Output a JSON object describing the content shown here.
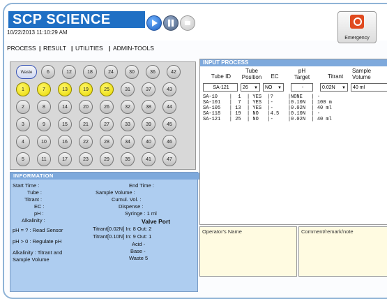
{
  "app": {
    "title": "SCP SCIENCE",
    "datetime": "10/22/2013 11:10:29 AM"
  },
  "controls": {
    "play": "play-icon",
    "pause": "pause-icon",
    "stop": "stop-icon",
    "emergency_label": "Emergency",
    "emergency_color": "#e04a1f"
  },
  "menu": {
    "items": [
      {
        "label": "PROCESS"
      },
      {
        "label": "RESULT"
      },
      {
        "label": "UTILITIES"
      },
      {
        "label": "ADMIN-TOOLS"
      }
    ]
  },
  "tube_rack": {
    "waste_label": "Waste",
    "rows": [
      [
        6,
        12,
        18,
        24,
        30,
        36,
        42
      ],
      [
        1,
        7,
        13,
        19,
        25,
        31,
        37,
        43
      ],
      [
        2,
        8,
        14,
        20,
        26,
        32,
        38,
        44
      ],
      [
        3,
        9,
        15,
        21,
        27,
        33,
        39,
        45
      ],
      [
        4,
        10,
        16,
        22,
        28,
        34,
        40,
        46
      ],
      [
        5,
        11,
        17,
        23,
        29,
        35,
        41,
        47
      ]
    ],
    "highlighted": [
      1,
      7,
      13,
      19,
      25
    ]
  },
  "information": {
    "title": "INFORMATION",
    "start_time": "Start Time :",
    "tube": "Tube :",
    "titrant": "Titrant :",
    "ec": "EC :",
    "ph": "pH :",
    "alkalinity": "Alkalinity :",
    "end_time": "End Time :",
    "sample_volume": "Sample Volume :",
    "cumul_vol": "Cumul. Vol. :",
    "dispense": "Dispense :",
    "syringe": "Syringe :  1 ml",
    "valve_port": "Valve Port",
    "titrant_002": "Titrant[0.02N]  In: 8    Out: 2",
    "titrant_010": "Titrant[0.10N]  In: 9    Out: 1",
    "acid": "Acid -",
    "base": "Base -",
    "waste": "Waste  5",
    "ph_read": "pH = ? : Read Sensor",
    "ph_regulate": "pH > 0 : Regulate pH",
    "alk_line1": "Alkalinity : Titrant and",
    "alk_line2": "Sample Volume"
  },
  "input_process": {
    "title": "INPUT PROCESS",
    "headers": {
      "tube_id": "Tube ID",
      "tube_position_1": "Tube",
      "tube_position_2": "Position",
      "ec": "EC",
      "ph_target_1": "pH",
      "ph_target_2": "Target",
      "titrant": "Titrant",
      "sample_volume_1": "Sample",
      "sample_volume_2": "Volume"
    },
    "row_inputs": {
      "tube_id": "SA-121",
      "position": "26",
      "ec": "NO",
      "ph": "-",
      "titrant": "0.02N",
      "sample_volume": "40 ml"
    },
    "lines": [
      "SA-10    |  1  | YES  |?     |NONE   | -",
      "SA-101   |  7  | YES  |-     |0.10N  | 100 m",
      "SA-105   | 13  | YES  |-     |0.02N  | 40 ml",
      "SA-118   | 19  | NO   |4.5   |0.10N  | -",
      "SA-121   | 25  | NO   |-     |0.02N  | 40 ml"
    ]
  },
  "operator": {
    "label": "Operator's Name"
  },
  "comment": {
    "label": "Comment/remark/note"
  }
}
